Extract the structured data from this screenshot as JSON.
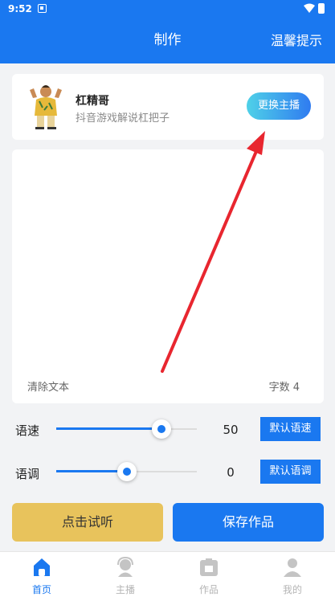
{
  "status_bar": {
    "time": "9:52"
  },
  "app_bar": {
    "title": "制作",
    "tips": "温馨提示"
  },
  "anchor": {
    "name": "杠精哥",
    "description": "抖音游戏解说杠把子",
    "switch_label": "更换主播"
  },
  "editor": {
    "text": "",
    "clear_label": "清除文本",
    "char_count": "字数 4"
  },
  "speed": {
    "label": "语速",
    "value": "50",
    "level": 0.75,
    "default_label": "默认语速"
  },
  "pitch": {
    "label": "语调",
    "value": "0",
    "level": 0.5,
    "default_label": "默认语调"
  },
  "actions": {
    "preview_label": "点击试听",
    "save_label": "保存作品"
  },
  "tabs": [
    {
      "label": "首页",
      "icon": "home-icon",
      "active": true
    },
    {
      "label": "主播",
      "icon": "anchor-icon",
      "active": false
    },
    {
      "label": "作品",
      "icon": "works-icon",
      "active": false
    },
    {
      "label": "我的",
      "icon": "profile-icon",
      "active": false
    }
  ],
  "colors": {
    "primary": "#1a78f0",
    "accent": "#e8c35c",
    "annotation_arrow": "#e8262f"
  }
}
